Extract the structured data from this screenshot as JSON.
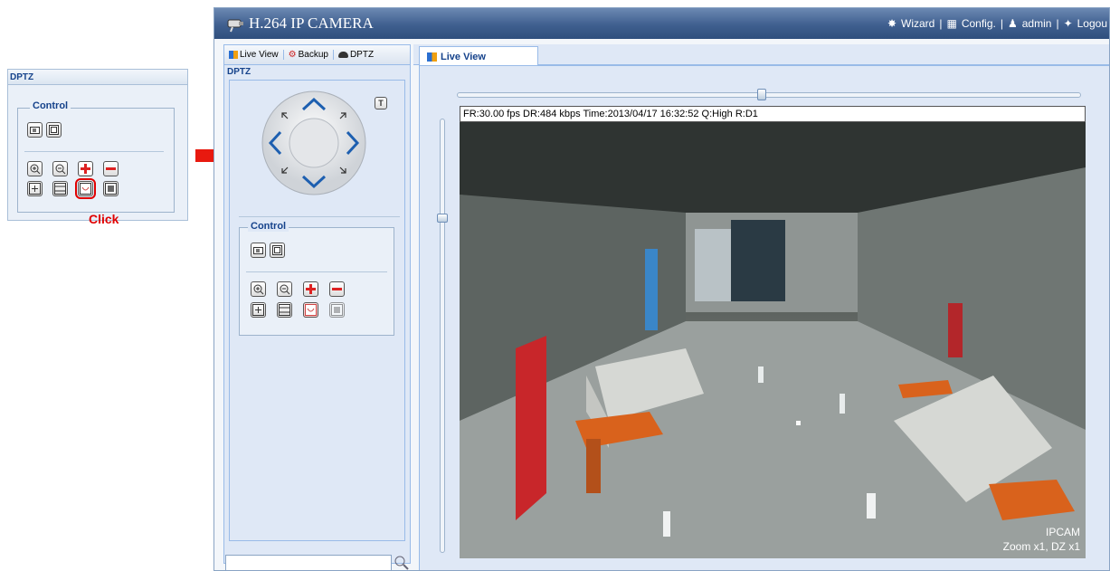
{
  "inset": {
    "header": "DPTZ",
    "control_label": "Control",
    "click_label": "Click"
  },
  "app": {
    "title": "H.264 IP CAMERA",
    "top_links": [
      "Wizard",
      "Config.",
      "admin",
      "Logou"
    ],
    "left_tabs": [
      "Live View",
      "Backup",
      "DPTZ"
    ],
    "dptz_header": "DPTZ",
    "control_label": "Control",
    "right_tab": "Live View",
    "info_bar": "FR:30.00 fps  DR:484 kbps Time:2013/04/17 16:32:52 Q:High R:D1",
    "overlay_camera": "IPCAM",
    "overlay_zoom": "Zoom x1, DZ x1",
    "search_placeholder": ""
  },
  "colors": {
    "accent": "#15428b",
    "titlebar": "#3f5f8f",
    "click_red": "#e00000"
  }
}
